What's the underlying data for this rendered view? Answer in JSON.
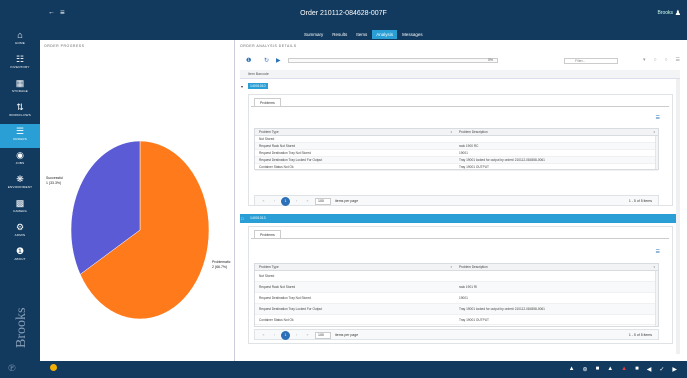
{
  "topbar": {
    "title": "Order 210112-084628-007F",
    "user": "Brooks"
  },
  "tabs": [
    "Summary",
    "Results",
    "Items",
    "Analysis",
    "Messages"
  ],
  "active_tab": "Analysis",
  "nav": [
    {
      "label": "HOME",
      "icon": "home-icon"
    },
    {
      "label": "INVENTORY",
      "icon": "inventory-icon"
    },
    {
      "label": "STORAGE",
      "icon": "storage-icon"
    },
    {
      "label": "WORKFLOWS",
      "icon": "workflows-icon"
    },
    {
      "label": "ORDERS",
      "icon": "orders-icon"
    },
    {
      "label": "JOBS",
      "icon": "jobs-icon"
    },
    {
      "label": "ENVIRONMENT",
      "icon": "environment-icon"
    },
    {
      "label": "CAMERA",
      "icon": "camera-icon"
    },
    {
      "label": "ADMIN",
      "icon": "admin-icon"
    },
    {
      "label": "ABOUT",
      "icon": "about-icon"
    }
  ],
  "active_nav": "ORDERS",
  "order_progress": {
    "heading": "ORDER PROGRESS"
  },
  "chart_data": {
    "type": "pie",
    "slices": [
      {
        "label": "Problematic",
        "value_label": "2 (66.7%)",
        "value": 66.7,
        "color": "#ff7a1a"
      },
      {
        "label": "Successful",
        "value_label": "1 (33.3%)",
        "value": 33.3,
        "color": "#5b5bd6"
      }
    ]
  },
  "analysis": {
    "heading": "ORDER ANALYSIS DETAILS",
    "progress_text": "0%",
    "filter_placeholder": "Filter...",
    "column_header": "Item Barcode",
    "groups": [
      {
        "name": "14001010",
        "tab": "Problems",
        "headers": [
          "Problem Type",
          "Problem Description"
        ],
        "rows": [
          [
            "Not Stored",
            ""
          ],
          [
            "Request Rack Not Stored",
            "rack 1900 RC"
          ],
          [
            "Request Destination Tray Not Stored",
            "19001"
          ],
          [
            "Request Destination Tray Locked For Output",
            "Tray 19001 locked for output by order# 210112-084558-0061"
          ],
          [
            "Container Status Not Ok",
            "Tray 19001 OUTPUT"
          ]
        ],
        "page": "1",
        "page_size": "100",
        "per_page_label": "items per page",
        "count": "1 - 5 of 5 items"
      },
      {
        "name": "14001013",
        "tab": "Problems",
        "headers": [
          "Problem Type",
          "Problem Description"
        ],
        "rows": [
          [
            "Not Stored",
            ""
          ],
          [
            "Request Rack Not Stored",
            "rack 1901 RI"
          ],
          [
            "Request Destination Tray Not Stored",
            "19001"
          ],
          [
            "Request Destination Tray Locked For Output",
            "Tray 19001 locked for output by order# 210112-084558-0061"
          ],
          [
            "Container Status Not Ok",
            "Tray 19001 OUTPUT"
          ]
        ],
        "page": "1",
        "page_size": "100",
        "per_page_label": "items per page",
        "count": "1 - 5 of 5 items"
      }
    ]
  },
  "brand": "Brooks"
}
